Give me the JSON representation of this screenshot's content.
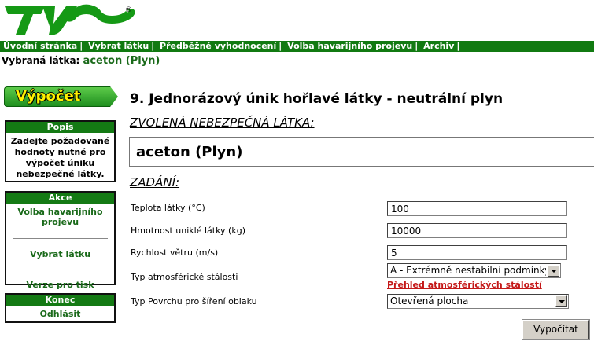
{
  "logo": {
    "registered": "®",
    "icon": "lizard-logo-icon"
  },
  "nav": {
    "items": [
      "Úvodní stránka",
      "Vybrat látku",
      "Předběžné vyhodnocení",
      "Volba havarijního projevu",
      "Archiv"
    ],
    "separator": "|"
  },
  "selected": {
    "label": "Vybraná látka:",
    "value": "aceton (Plyn)"
  },
  "sidebar": {
    "badge": "Výpočet",
    "popis": {
      "header": "Popis",
      "text": "Zadejte požadované hodnoty nutné pro výpočet úniku nebezpečné látky."
    },
    "akce": {
      "header": "Akce",
      "links": [
        "Volba havarijního projevu",
        "Vybrat látku",
        "Verze pro tisk"
      ]
    },
    "konec": {
      "header": "Konec",
      "link": "Odhlásit"
    }
  },
  "main": {
    "title": "9. Jednorázový únik hořlavé látky - neutrální plyn",
    "substance_heading": "ZVOLENÁ NEBEZPEČNÁ LÁTKA:",
    "substance": "aceton (Plyn)",
    "input_heading": "ZADÁNÍ:",
    "fields": [
      {
        "label": "Teplota látky (°C)",
        "value": "100"
      },
      {
        "label": "Hmotnost uniklé látky (kg)",
        "value": "10000"
      },
      {
        "label": "Rychlost větru (m/s)",
        "value": "5"
      }
    ],
    "stability": {
      "label": "Typ atmosférické stálosti",
      "selected": "A - Extrémně nestabilní podmínky",
      "link": "Přehled atmosférických stálostí"
    },
    "surface": {
      "label": "Typ Povrchu pro šíření oblaku",
      "selected": "Otevřená plocha"
    },
    "submit": "Vypočítat"
  },
  "colors": {
    "nav_green": "#117a11",
    "link_red": "#c41818",
    "badge_yellow": "#fff200"
  }
}
